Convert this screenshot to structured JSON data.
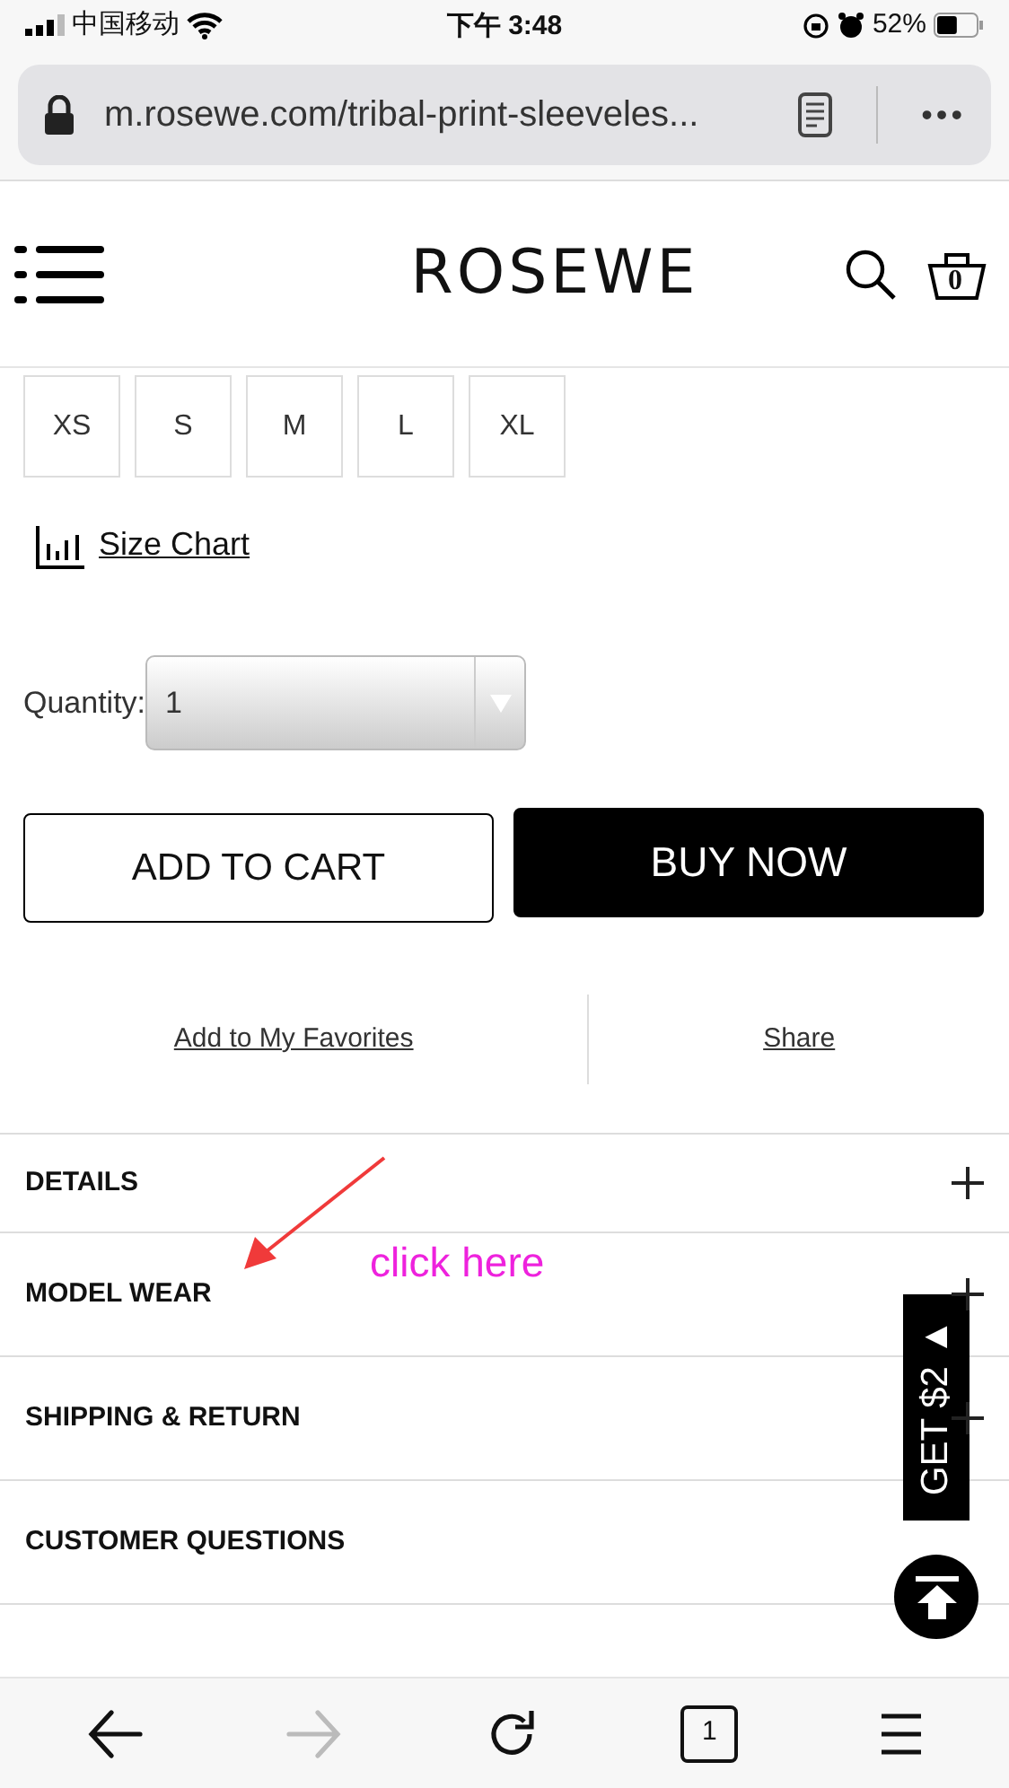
{
  "status_bar": {
    "carrier": "中国移动",
    "time": "下午 3:48",
    "battery_text": "52%",
    "battery": {
      "level": 0.52
    }
  },
  "address_bar": {
    "url": "m.rosewe.com/tribal-print-sleeveles...",
    "more": "•••"
  },
  "header": {
    "logo": "ROSEWE",
    "cart_count": "0"
  },
  "sizes": [
    {
      "label": "XS",
      "selected": false
    },
    {
      "label": "S",
      "selected": false
    },
    {
      "label": "M",
      "selected": false
    },
    {
      "label": "L",
      "selected": false
    },
    {
      "label": "XL",
      "selected": false
    }
  ],
  "size_chart": "Size Chart",
  "quantity": {
    "label": "Quantity:",
    "value": "1"
  },
  "buttons": [
    {
      "label": "ADD TO CART",
      "kind": "outline"
    },
    {
      "label": "BUY NOW",
      "kind": "solid"
    }
  ],
  "links": [
    "Add to My Favorites",
    "Share"
  ],
  "sections": [
    {
      "title": "DETAILS",
      "plus": true
    },
    {
      "title": "MODEL WEAR",
      "plus": true
    },
    {
      "title": "SHIPPING & RETURN",
      "plus": true
    },
    {
      "title": "CUSTOMER QUESTIONS",
      "plus": false
    }
  ],
  "annotation": {
    "text": "click here"
  },
  "promo_tab": "GET $2 ▲",
  "toolbar": {
    "back_disabled": false,
    "forward_disabled": true,
    "tab_count": "1"
  }
}
